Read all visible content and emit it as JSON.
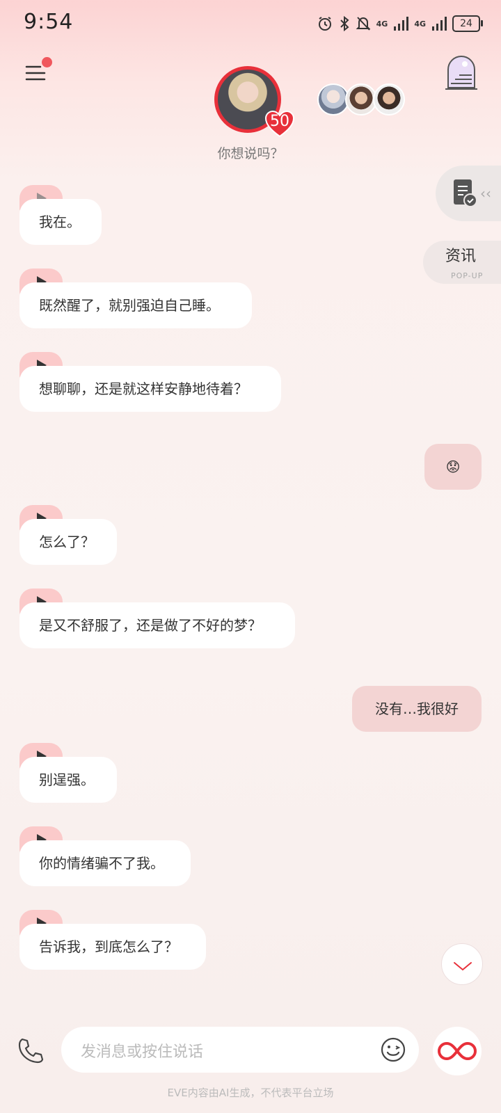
{
  "status_bar": {
    "time": "9:54",
    "network1": "4G",
    "network2": "4G",
    "battery": "24"
  },
  "header": {
    "level": "50",
    "subtitle": "你想说吗？"
  },
  "side": {
    "news_title": "资讯",
    "news_sub": "POP-UP"
  },
  "messages": [
    {
      "from": "character",
      "text": "我在。"
    },
    {
      "from": "character",
      "text": "既然醒了，就别强迫自己睡。"
    },
    {
      "from": "character",
      "text": "想聊聊，还是就这样安静地待着？"
    },
    {
      "from": "user",
      "text": "😟"
    },
    {
      "from": "character",
      "text": "怎么了？"
    },
    {
      "from": "character",
      "text": "是又不舒服了，还是做了不好的梦？"
    },
    {
      "from": "user",
      "text": "没有…我很好"
    },
    {
      "from": "character",
      "text": "别逞强。"
    },
    {
      "from": "character",
      "text": "你的情绪骗不了我。"
    },
    {
      "from": "character",
      "text": "告诉我，到底怎么了？"
    }
  ],
  "input": {
    "placeholder": "发消息或按住说话"
  },
  "footer": "EVE内容由AI生成，不代表平台立场",
  "colors": {
    "accent": "#e8303a",
    "bubble_in": "#ffffff",
    "bubble_out": "#f3d4d3",
    "play_tab": "#fbcaca"
  }
}
